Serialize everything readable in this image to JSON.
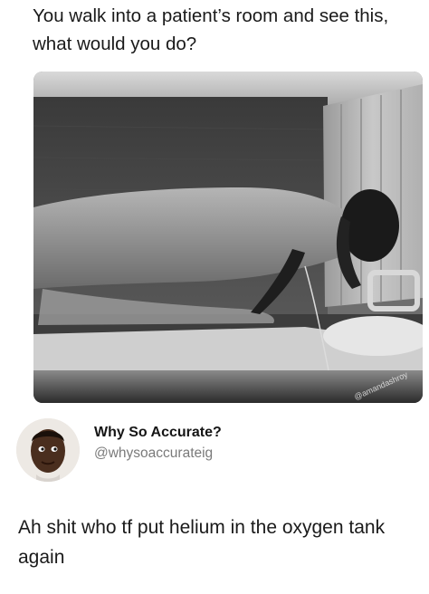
{
  "post": {
    "caption": "You walk into a patient’s room and see this, what would you do?",
    "image_watermark": "@amandashroy"
  },
  "tweet": {
    "display_name": "Why So Accurate?",
    "handle": "@whysoaccurateig",
    "text": "Ah shit who tf put helium in the oxygen tank again"
  }
}
